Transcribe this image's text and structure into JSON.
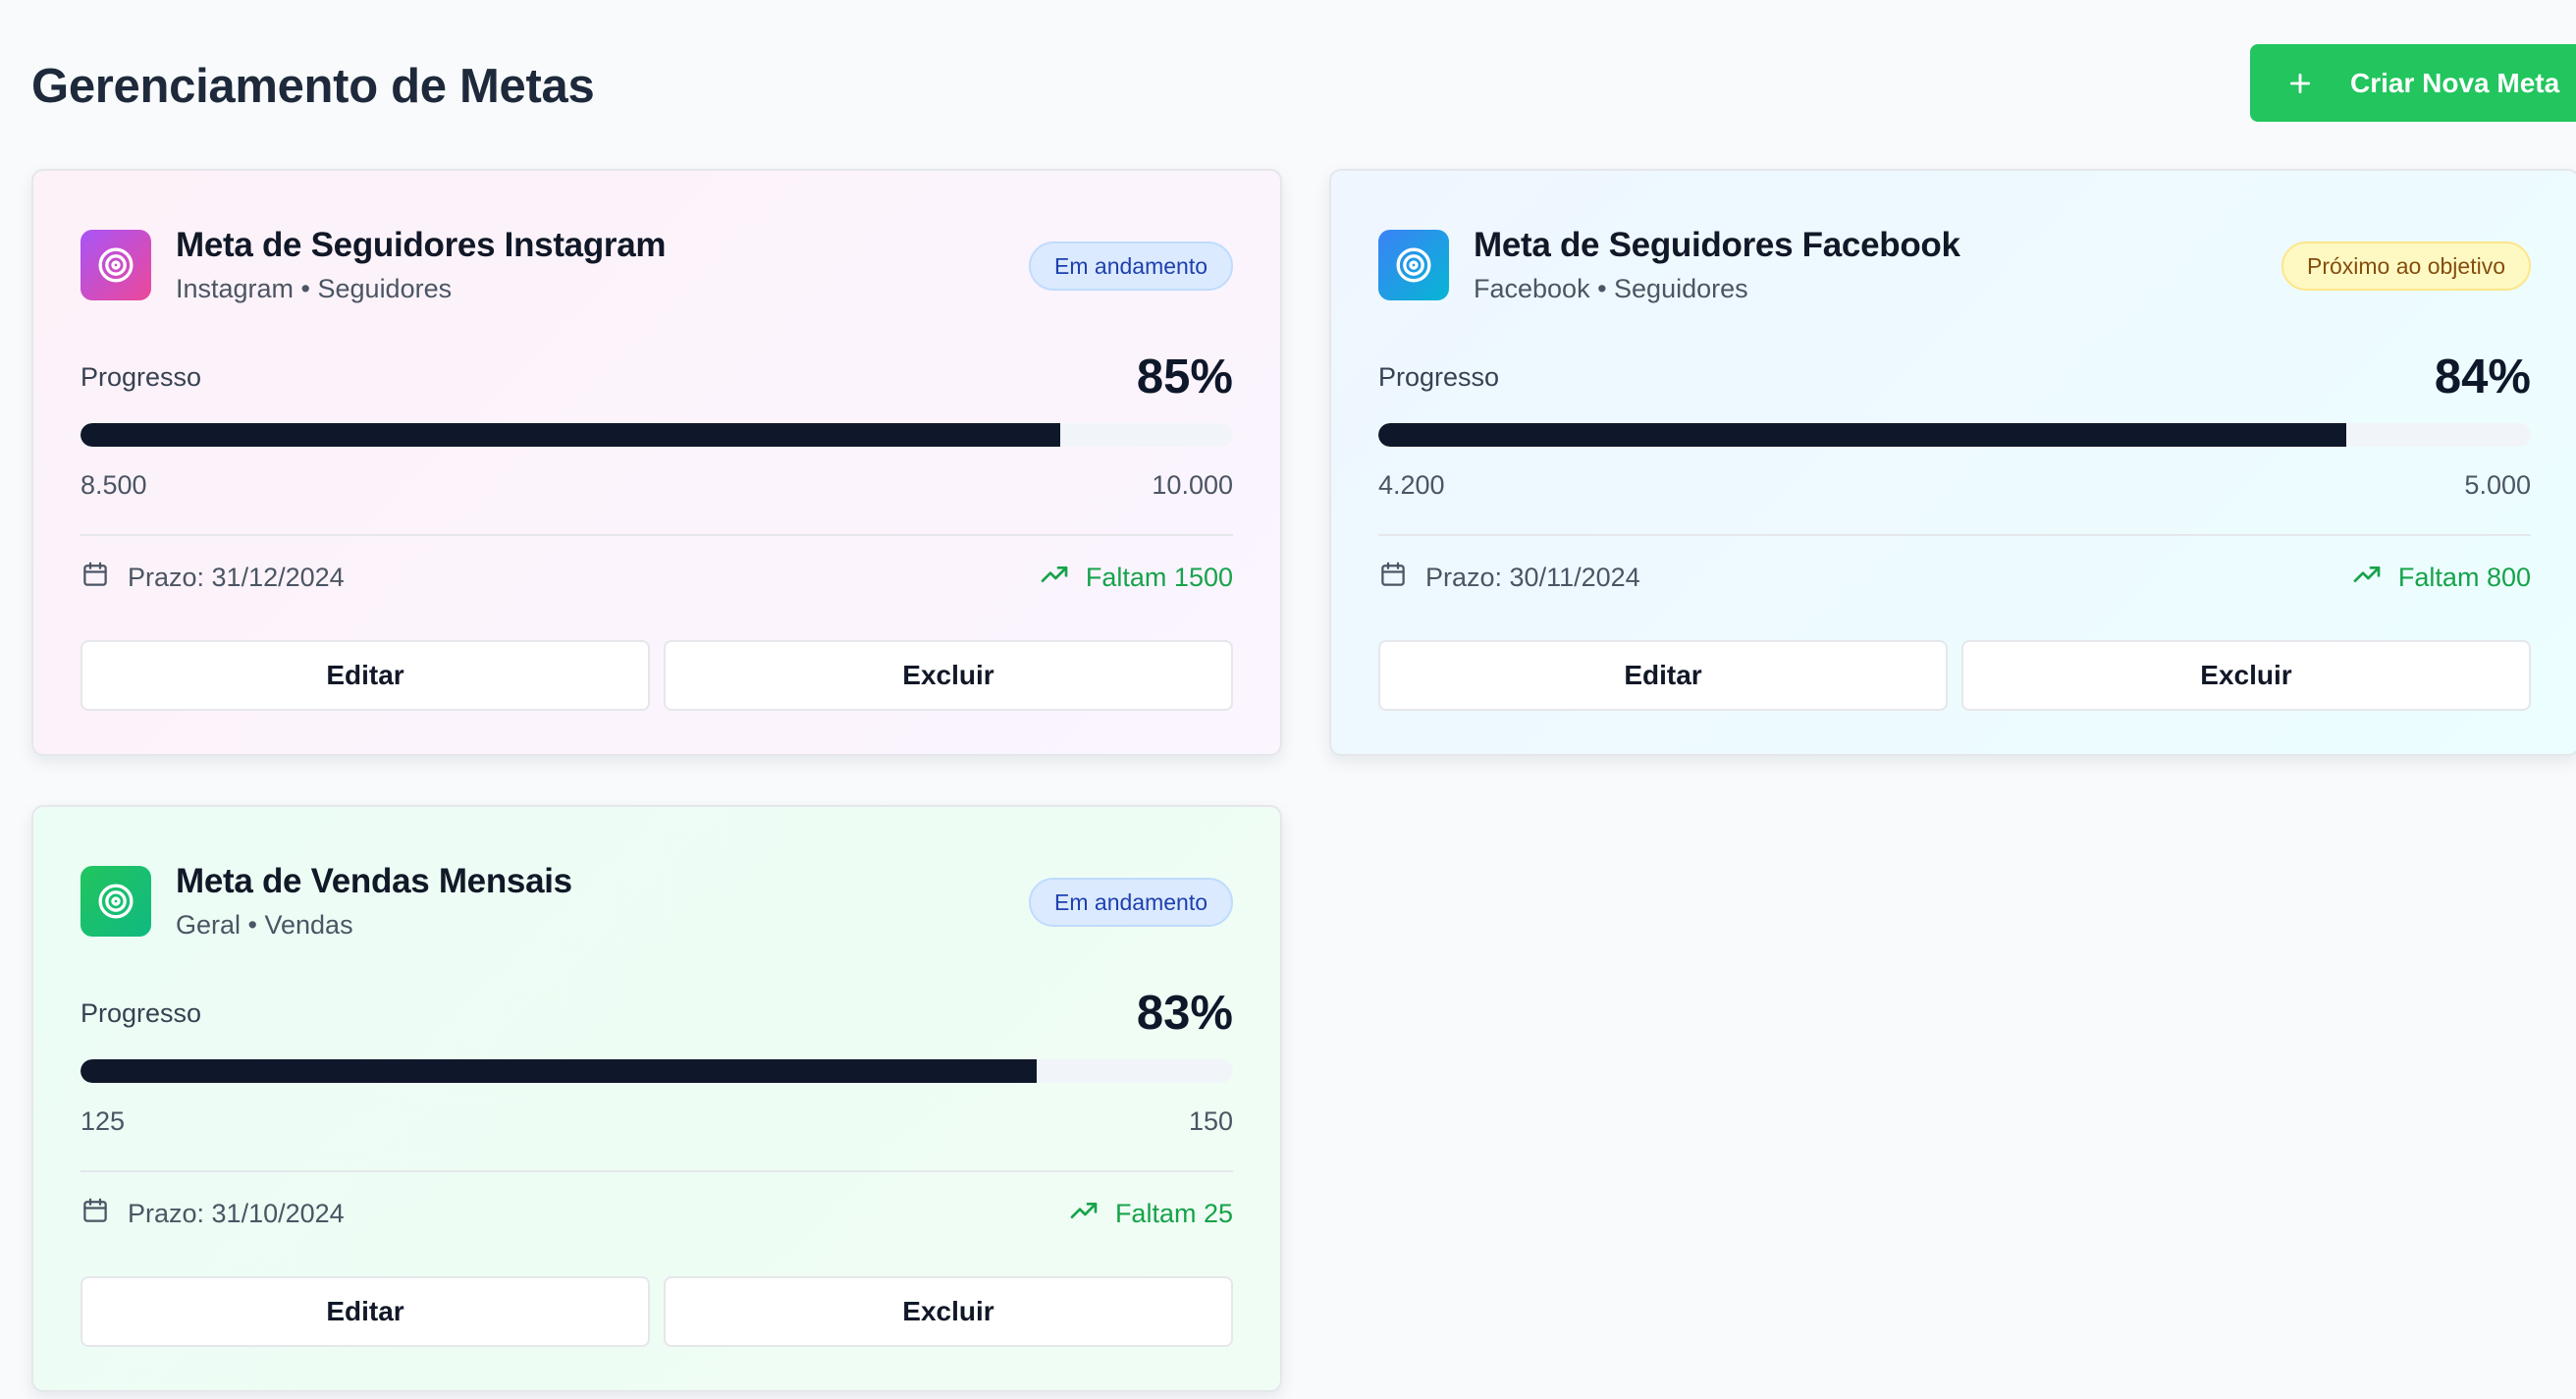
{
  "page": {
    "title": "Gerenciamento de Metas",
    "create_button_label": "Criar Nova Meta"
  },
  "goals": [
    {
      "title": "Meta de Seguidores Instagram",
      "subtitle": "Instagram • Seguidores",
      "status": "Em andamento",
      "progress_label": "Progresso",
      "percent_text": "85%",
      "progress_fraction": 0.85,
      "current": "8.500",
      "target": "10.000",
      "deadline": "Prazo: 31/12/2024",
      "remaining": "Faltam 1500",
      "edit_label": "Editar",
      "delete_label": "Excluir"
    },
    {
      "title": "Meta de Seguidores Facebook",
      "subtitle": "Facebook • Seguidores",
      "status": "Próximo ao objetivo",
      "progress_label": "Progresso",
      "percent_text": "84%",
      "progress_fraction": 0.84,
      "current": "4.200",
      "target": "5.000",
      "deadline": "Prazo: 30/11/2024",
      "remaining": "Faltam 800",
      "edit_label": "Editar",
      "delete_label": "Excluir"
    },
    {
      "title": "Meta de Vendas Mensais",
      "subtitle": "Geral • Vendas",
      "status": "Em andamento",
      "progress_label": "Progresso",
      "percent_text": "83%",
      "progress_fraction": 0.83,
      "current": "125",
      "target": "150",
      "deadline": "Prazo: 31/10/2024",
      "remaining": "Faltam 25",
      "edit_label": "Editar",
      "delete_label": "Excluir"
    }
  ],
  "icons": {
    "goal": "target-icon",
    "deadline": "calendar-icon",
    "remaining": "trending-up-icon",
    "create": "plus-icon"
  },
  "colors": {
    "accent_green": "#22c55e",
    "progress_fill": "#0f172a",
    "remaining_text": "#16a34a",
    "badge_in_progress": "#dbeafe",
    "badge_near_goal": "#fef9c3"
  }
}
